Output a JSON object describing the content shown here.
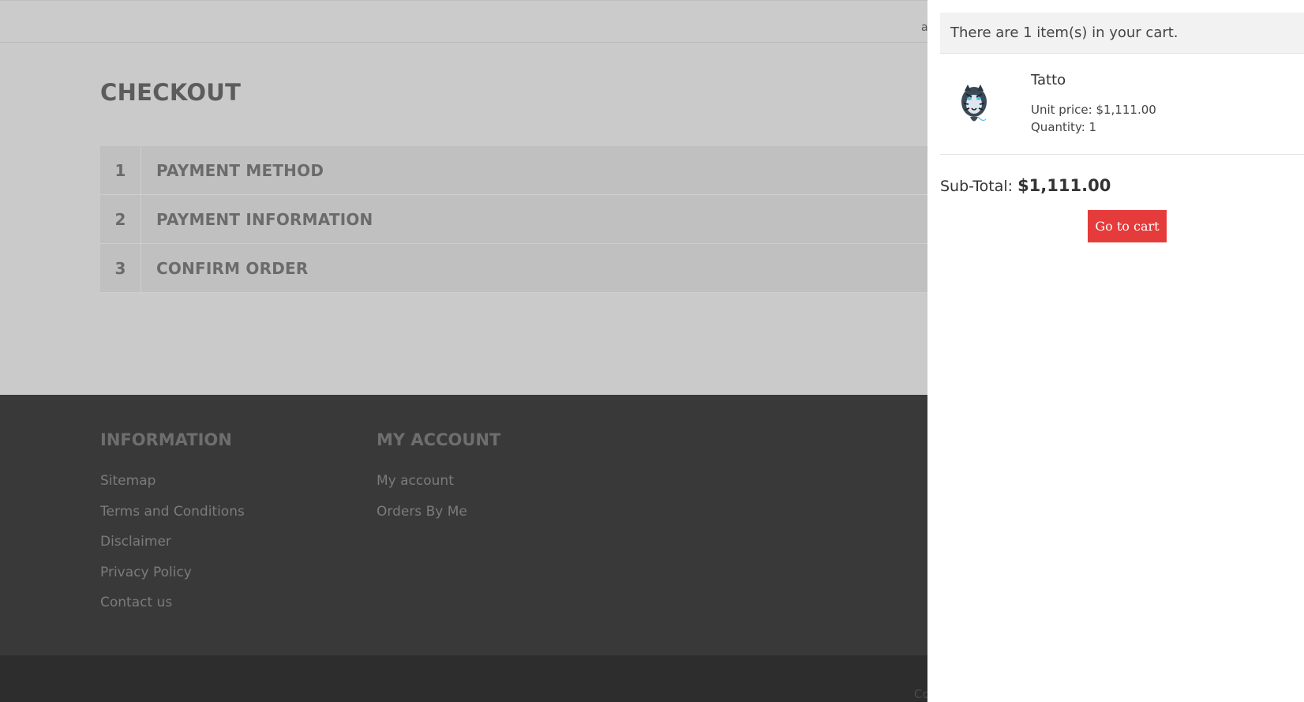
{
  "topbar": {
    "fragment": "a"
  },
  "page": {
    "title": "CHECKOUT"
  },
  "steps": [
    {
      "number": "1",
      "label": "PAYMENT METHOD"
    },
    {
      "number": "2",
      "label": "PAYMENT INFORMATION"
    },
    {
      "number": "3",
      "label": "CONFIRM ORDER"
    }
  ],
  "footer": {
    "information": {
      "heading": "INFORMATION",
      "links": [
        "Sitemap",
        "Terms and Conditions",
        "Disclaimer",
        "Privacy Policy",
        "Contact us"
      ]
    },
    "account": {
      "heading": "MY ACCOUNT",
      "links": [
        "My account",
        "Orders By Me"
      ]
    },
    "bottom_fragment": "Co"
  },
  "cart": {
    "summary": "There are 1 item(s) in your cart.",
    "item": {
      "name": "Tatto",
      "unit_price": "Unit price: $1,111.00",
      "quantity": "Quantity: 1",
      "thumbnail_icon": "tiger-tattoo-image"
    },
    "subtotal_label": "Sub-Total:",
    "subtotal_value": "$1,111.00",
    "go_to_cart": "Go to cart",
    "button_color": "#e63b3b"
  }
}
